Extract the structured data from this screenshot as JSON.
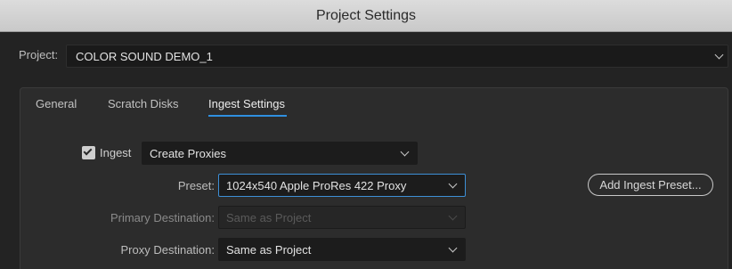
{
  "window": {
    "title": "Project Settings"
  },
  "project": {
    "label": "Project:",
    "value": "COLOR SOUND DEMO_1"
  },
  "tabs": [
    {
      "label": "General"
    },
    {
      "label": "Scratch Disks"
    },
    {
      "label": "Ingest Settings",
      "active": true
    }
  ],
  "ingest": {
    "checkbox_label": "Ingest",
    "checked": true,
    "mode_value": "Create Proxies"
  },
  "preset": {
    "label": "Preset:",
    "value": "1024x540 Apple ProRes 422 Proxy"
  },
  "add_preset_button": {
    "label": "Add Ingest Preset..."
  },
  "primary_destination": {
    "label": "Primary Destination:",
    "value": "Same as Project",
    "disabled": true
  },
  "proxy_destination": {
    "label": "Proxy Destination:",
    "value": "Same as Project"
  },
  "colors": {
    "accent": "#2f8fe0",
    "titlebar": "#d4d4d4",
    "background": "#232323",
    "panel": "#2c2c2c"
  }
}
